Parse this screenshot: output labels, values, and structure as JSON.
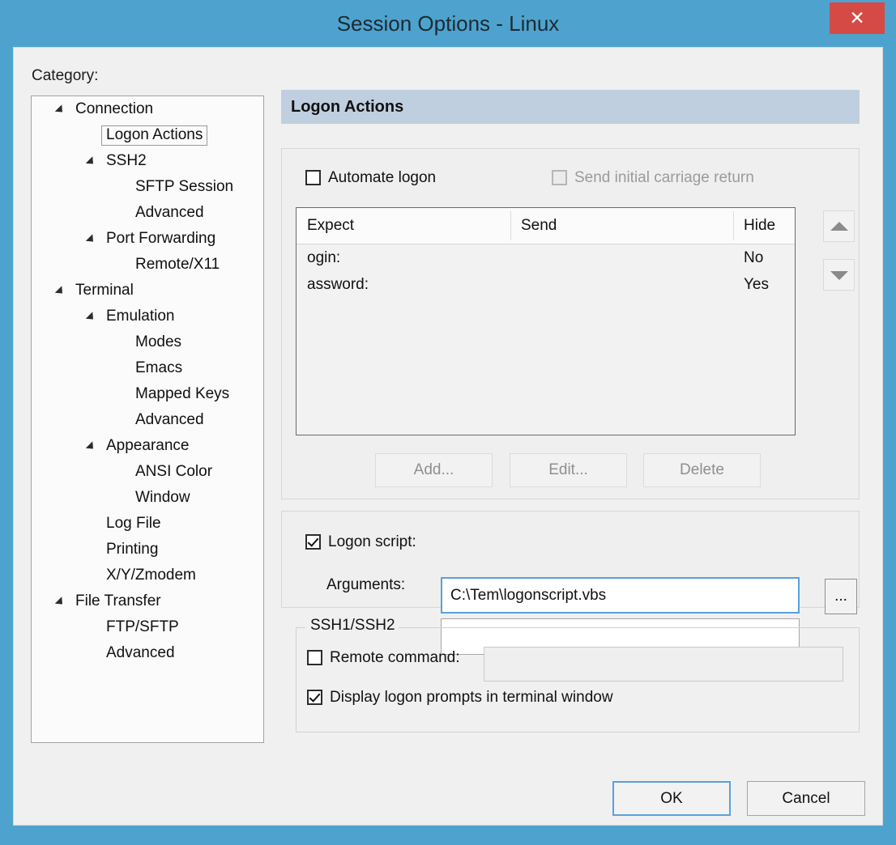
{
  "window": {
    "title": "Session Options - Linux",
    "close_label": "✕",
    "titlebar_color": "#4da3cd",
    "close_color": "#d64a45"
  },
  "sidebar": {
    "label": "Category:",
    "items": [
      {
        "label": "Connection",
        "level": 0,
        "expander": true,
        "selected": false
      },
      {
        "label": "Logon Actions",
        "level": 1,
        "expander": false,
        "selected": true
      },
      {
        "label": "SSH2",
        "level": 1,
        "expander": true,
        "selected": false
      },
      {
        "label": "SFTP Session",
        "level": 2,
        "expander": false,
        "selected": false
      },
      {
        "label": "Advanced",
        "level": 2,
        "expander": false,
        "selected": false
      },
      {
        "label": "Port Forwarding",
        "level": 1,
        "expander": true,
        "selected": false
      },
      {
        "label": "Remote/X11",
        "level": 2,
        "expander": false,
        "selected": false
      },
      {
        "label": "Terminal",
        "level": 0,
        "expander": true,
        "selected": false
      },
      {
        "label": "Emulation",
        "level": 1,
        "expander": true,
        "selected": false
      },
      {
        "label": "Modes",
        "level": 2,
        "expander": false,
        "selected": false
      },
      {
        "label": "Emacs",
        "level": 2,
        "expander": false,
        "selected": false
      },
      {
        "label": "Mapped Keys",
        "level": 2,
        "expander": false,
        "selected": false
      },
      {
        "label": "Advanced",
        "level": 2,
        "expander": false,
        "selected": false
      },
      {
        "label": "Appearance",
        "level": 1,
        "expander": true,
        "selected": false
      },
      {
        "label": "ANSI Color",
        "level": 2,
        "expander": false,
        "selected": false
      },
      {
        "label": "Window",
        "level": 2,
        "expander": false,
        "selected": false
      },
      {
        "label": "Log File",
        "level": 1,
        "expander": false,
        "selected": false
      },
      {
        "label": "Printing",
        "level": 1,
        "expander": false,
        "selected": false
      },
      {
        "label": "X/Y/Zmodem",
        "level": 1,
        "expander": false,
        "selected": false
      },
      {
        "label": "File Transfer",
        "level": 0,
        "expander": true,
        "selected": false
      },
      {
        "label": "FTP/SFTP",
        "level": 1,
        "expander": false,
        "selected": false
      },
      {
        "label": "Advanced",
        "level": 1,
        "expander": false,
        "selected": false
      }
    ]
  },
  "pane": {
    "header": "Logon Actions",
    "header_color": "#c0cfdf"
  },
  "automate": {
    "automate_logon_label": "Automate logon",
    "automate_logon_checked": false,
    "send_cr_label": "Send initial carriage return",
    "send_cr_checked": false,
    "send_cr_disabled": true,
    "columns": [
      "Expect",
      "Send",
      "Hide"
    ],
    "rows": [
      {
        "expect": "ogin:",
        "send": "",
        "hide": "No"
      },
      {
        "expect": "assword:",
        "send": "",
        "hide": "Yes"
      }
    ],
    "move_up_icon": "triangle-up-icon",
    "move_down_icon": "triangle-down-icon",
    "add_label": "Add...",
    "edit_label": "Edit...",
    "delete_label": "Delete",
    "buttons_disabled": true
  },
  "script": {
    "logon_script_label": "Logon script:",
    "logon_script_checked": true,
    "logon_script_value": "C:\\Tem\\logonscript.vbs",
    "logon_script_placeholder": "",
    "browse_label": "...",
    "arguments_label": "Arguments:",
    "arguments_value": "",
    "arguments_placeholder": ""
  },
  "ssh": {
    "legend": "SSH1/SSH2",
    "remote_command_label": "Remote command:",
    "remote_command_checked": false,
    "remote_command_value": "",
    "remote_command_placeholder": "",
    "remote_command_disabled": true,
    "display_prompts_label": "Display logon prompts in terminal window",
    "display_prompts_checked": true
  },
  "footer": {
    "ok_label": "OK",
    "cancel_label": "Cancel",
    "accent_color": "#5aa0dc"
  }
}
